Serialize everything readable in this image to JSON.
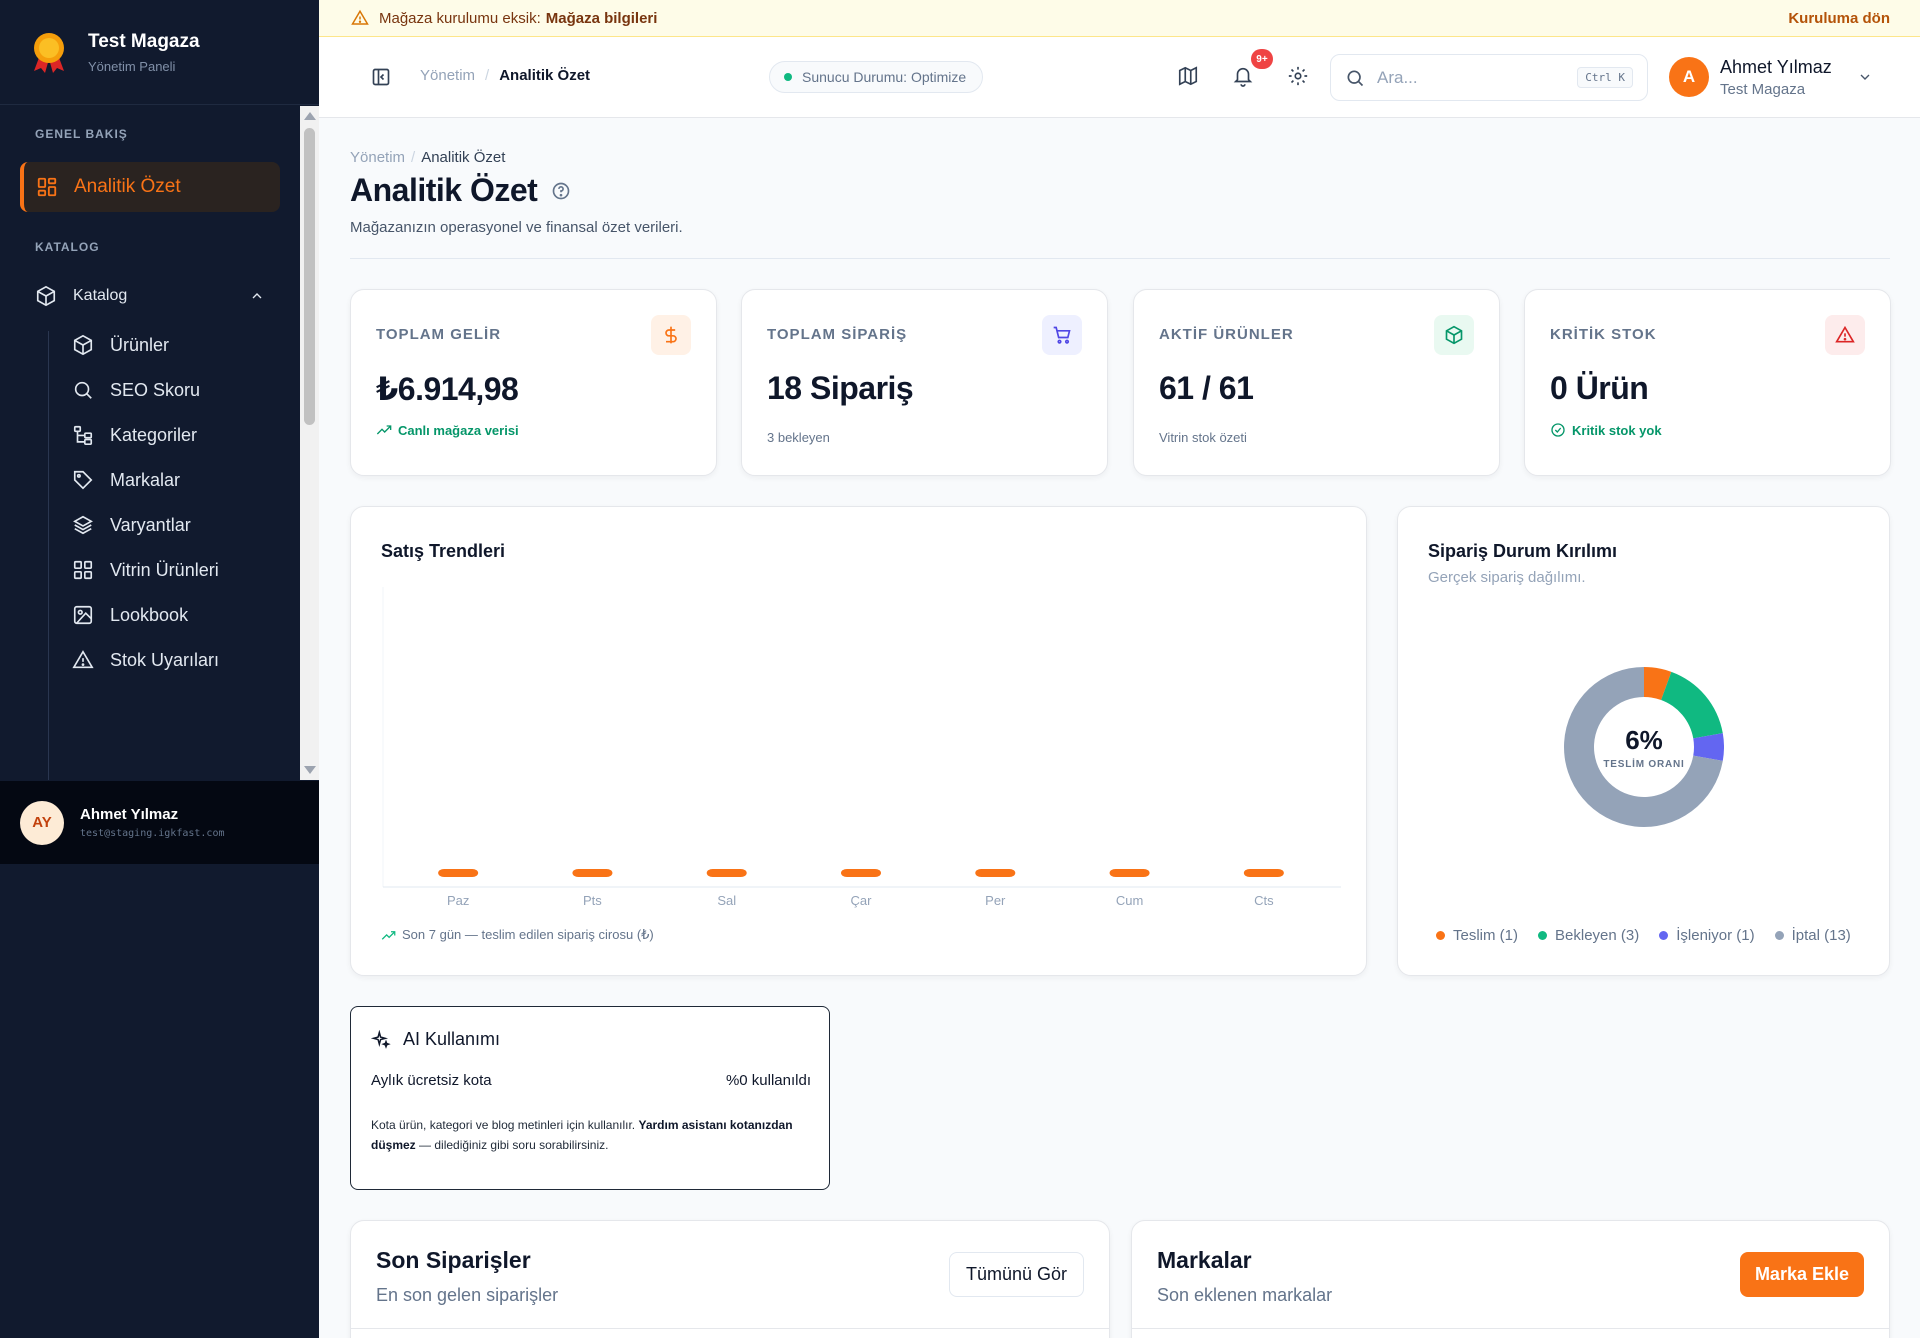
{
  "brand": {
    "title": "Test Magaza",
    "subtitle": "Yönetim Paneli"
  },
  "sidebar": {
    "section_overview": "GENEL BAKIŞ",
    "active_item": "Analitik Özet",
    "section_catalog": "KATALOG",
    "catalog_label": "Katalog",
    "catalog_items": [
      {
        "label": "Ürünler",
        "icon": "box-icon"
      },
      {
        "label": "SEO Skoru",
        "icon": "search-icon"
      },
      {
        "label": "Kategoriler",
        "icon": "tree-icon"
      },
      {
        "label": "Markalar",
        "icon": "tag-icon"
      },
      {
        "label": "Varyantlar",
        "icon": "layers-icon"
      },
      {
        "label": "Vitrin Ürünleri",
        "icon": "grid-icon"
      },
      {
        "label": "Lookbook",
        "icon": "image-icon"
      },
      {
        "label": "Stok Uyarıları",
        "icon": "warning-icon"
      }
    ],
    "user": {
      "initials": "AY",
      "name": "Ahmet Yılmaz",
      "email": "test@staging.igkfast.com"
    }
  },
  "alert": {
    "text": "Mağaza kurulumu eksik:",
    "strong": "Mağaza bilgileri",
    "action": "Kuruluma dön"
  },
  "topbar": {
    "crumb_root": "Yönetim",
    "crumb_current": "Analitik Özet",
    "server_status": "Sunucu Durumu: Optimize",
    "notif_badge": "9+",
    "search_placeholder": "Ara...",
    "search_shortcut": "Ctrl K",
    "user_initial": "A",
    "user_name": "Ahmet Yılmaz",
    "user_store": "Test Magaza"
  },
  "page": {
    "crumb_root": "Yönetim",
    "crumb_current": "Analitik Özet",
    "title": "Analitik Özet",
    "subtitle": "Mağazanızın operasyonel ve finansal özet verileri."
  },
  "stats": [
    {
      "label": "TOPLAM GELİR",
      "value": "₺6.914,98",
      "note": "Canlı mağaza verisi",
      "icon": "dollar-icon",
      "color": "#f97316",
      "bg": "#fff1e6"
    },
    {
      "label": "TOPLAM SİPARİŞ",
      "value": "18 Sipariş",
      "note": "3 bekleyen",
      "icon": "cart-icon",
      "color": "#4f46e5",
      "bg": "#eef0ff"
    },
    {
      "label": "AKTİF ÜRÜNLER",
      "value": "61 / 61",
      "note": "Vitrin stok özeti",
      "icon": "box-icon",
      "color": "#059669",
      "bg": "#e9f9f1"
    },
    {
      "label": "KRİTİK STOK",
      "value": "0 Ürün",
      "note": "Kritik stok yok",
      "icon": "warning-icon",
      "color": "#dc2626",
      "bg": "#fdecec"
    }
  ],
  "sales_chart": {
    "title": "Satış Trendleri",
    "note": "Son 7 gün — teslim edilen sipariş cirosu (₺)"
  },
  "status_chart": {
    "title": "Sipariş Durum Kırılımı",
    "subtitle": "Gerçek sipariş dağılımı.",
    "center_value": "6%",
    "center_label": "TESLİM ORANI",
    "legend": [
      "Teslim (1)",
      "Bekleyen (3)",
      "İşleniyor (1)",
      "İptal (13)"
    ]
  },
  "chart_data": [
    {
      "type": "bar",
      "title": "Satış Trendleri",
      "categories": [
        "Paz",
        "Pts",
        "Sal",
        "Çar",
        "Per",
        "Cum",
        "Cts"
      ],
      "values": [
        0,
        0,
        0,
        0,
        0,
        0,
        0
      ],
      "color": "#f97316"
    },
    {
      "type": "pie",
      "title": "Sipariş Durum Kırılımı",
      "labels": [
        "Teslim",
        "Bekleyen",
        "İşleniyor",
        "İptal"
      ],
      "values": [
        1,
        3,
        1,
        13
      ],
      "colors": [
        "#f97316",
        "#10b981",
        "#6366f1",
        "#94a3b8"
      ]
    }
  ],
  "ai": {
    "title": "AI Kullanımı",
    "quota_label": "Aylık ücretsiz kota",
    "quota_value": "%0 kullanıldı",
    "desc_1": "Kota ürün, kategori ve blog metinleri için kullanılır.",
    "desc_strong": "Yardım asistanı kotanızdan düşmez",
    "desc_2": "— dilediğiniz gibi soru sorabilirsiniz."
  },
  "recent_orders": {
    "title": "Son Siparişler",
    "subtitle": "En son gelen siparişler",
    "button": "Tümünü Gör"
  },
  "brands": {
    "title": "Markalar",
    "subtitle": "Son eklenen markalar",
    "button": "Marka Ekle"
  }
}
